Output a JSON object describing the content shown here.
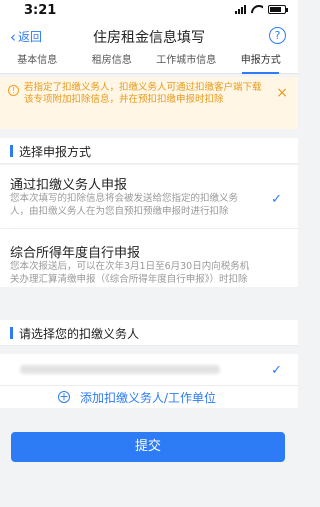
{
  "status_bar": {
    "time": "3:21"
  },
  "navbar": {
    "back_label": "返回",
    "title": "住房租金信息填写",
    "help_label": "?"
  },
  "steps": [
    "基本信息",
    "租房信息",
    "工作城市信息",
    "申报方式"
  ],
  "notice": {
    "text": "若指定了扣缴义务人，扣缴义务人可通过扣缴客户端下载该专项附加扣除信息，并在预扣扣缴申报时扣除",
    "close_label": "×"
  },
  "section_declare": {
    "label": "选择申报方式"
  },
  "options": [
    {
      "title": "通过扣缴义务人申报",
      "desc": "您本次填写的扣除信息将会被发送给您指定的扣缴义务人，由扣缴义务人在为您自预扣预缴申报时进行扣除",
      "selected": true
    },
    {
      "title": "综合所得年度自行申报",
      "desc": "您本次报送后，可以在次年3月1日至6月30日内向税务机关办理汇算清缴申报（《综合所得年度自行申报》）时扣除",
      "selected": false
    }
  ],
  "section_agent": {
    "label": "请选择您的扣缴义务人"
  },
  "add_agent": {
    "label": "添加扣缴义务人/工作单位"
  },
  "submit": {
    "label": "提交"
  },
  "colors": {
    "accent": "#2d7cf6",
    "notice_bg": "#fff6e5",
    "notice_text": "#e89a1c"
  }
}
